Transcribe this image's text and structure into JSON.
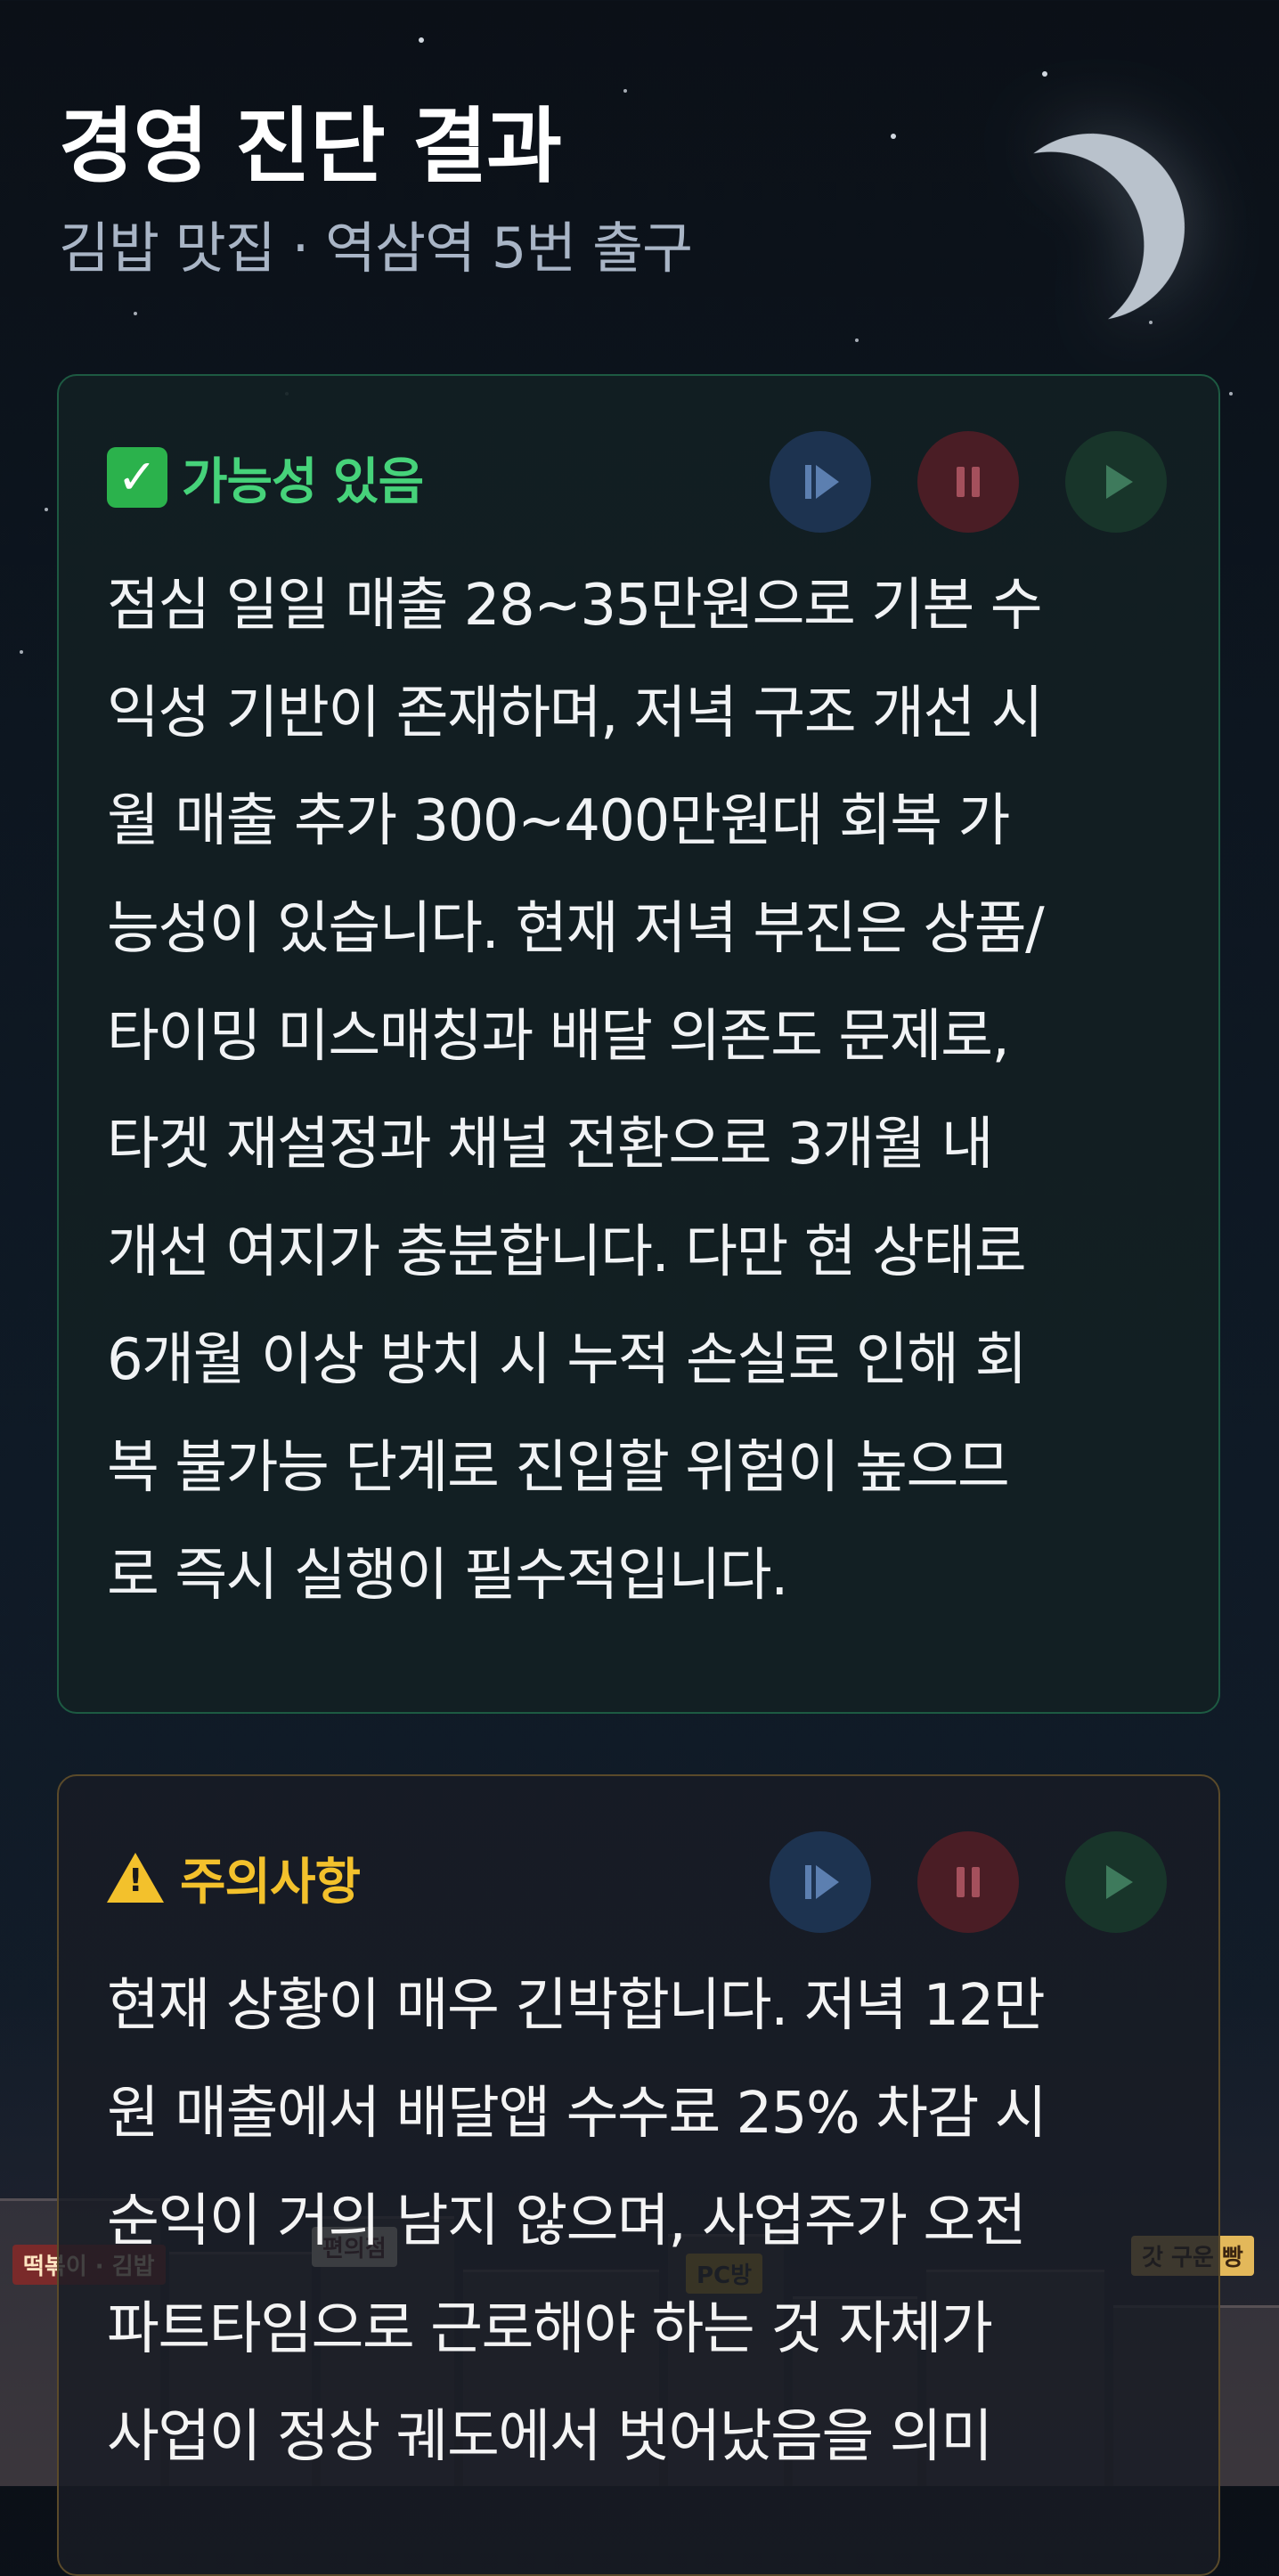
{
  "header": {
    "title": "경영 진단 결과",
    "subtitle": "김밥 맛집 · 역삼역 5번 출구"
  },
  "cards": [
    {
      "type": "success",
      "icon": "check-mark",
      "title": "가능성 있음",
      "body": "점심 일일 매출 28~35만원으로 기본 수\n익성 기반이 존재하며, 저녁 구조 개선 시\n월 매출 추가 300~400만원대 회복 가\n능성이 있습니다. 현재 저녁 부진은 상품/\n타이밍 미스매칭과 배달 의존도 문제로,\n타겟 재설정과 채널 전환으로 3개월 내\n개선 여지가 충분합니다. 다만 현 상태로\n6개월 이상 방치 시 누적 손실로 인해 회\n복 불가능 단계로 진입할 위험이 높으므\n로 즉시 실행이 필수적입니다."
    },
    {
      "type": "warning",
      "icon": "warning-triangle",
      "title": "주의사항",
      "body": "현재 상황이 매우 긴박합니다. 저녁 12만\n원 매출에서 배달앱 수수료 25% 차감 시\n순익이 거의 남지 않으며, 사업주가 오전\n파트타임으로 근로해야 하는 것 자체가\n사업이 정상 궤도에서 벗어났음을 의미"
    }
  ],
  "controls": {
    "skip": "skip-icon",
    "pause": "pause-icon",
    "play": "play-icon"
  },
  "street_signs": [
    "떡볶이 · 김밥",
    "편의점",
    "PC방",
    "갓 구운 빵"
  ],
  "colors": {
    "success": "#46d37a",
    "warning": "#f3c12c",
    "background": "#0d1620"
  }
}
